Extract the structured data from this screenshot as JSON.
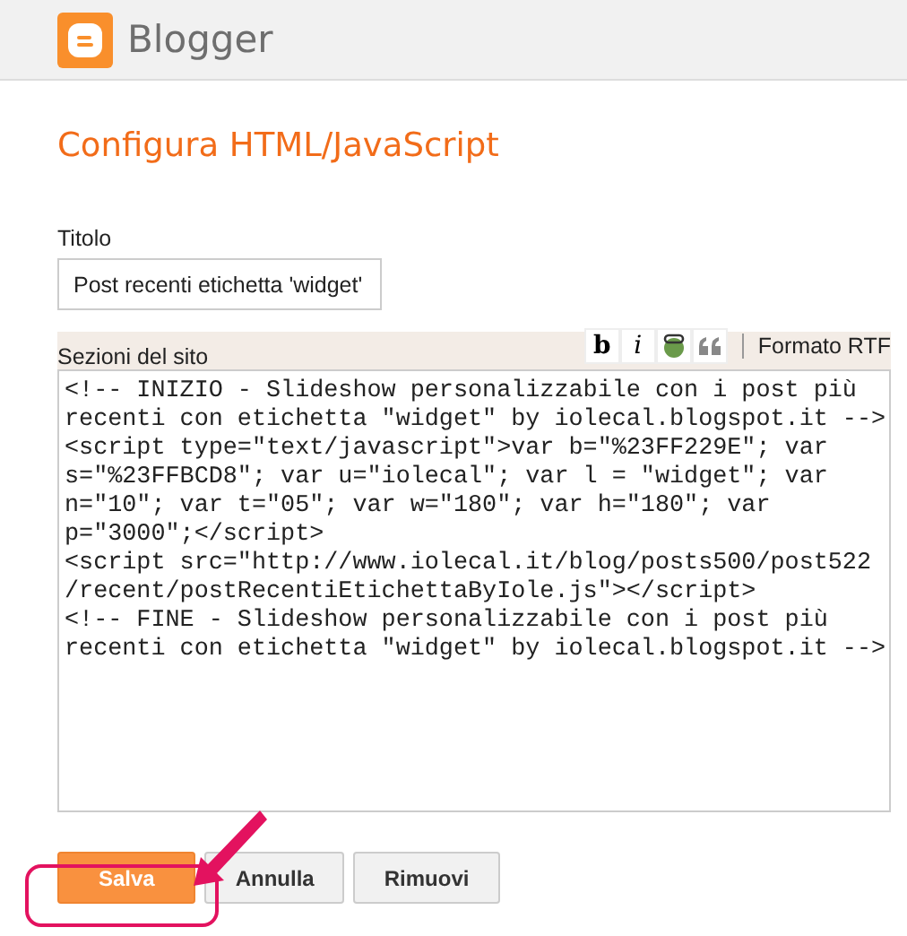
{
  "header": {
    "brand": "Blogger"
  },
  "page_title": "Configura HTML/JavaScript",
  "title_field": {
    "label": "Titolo",
    "value": "Post recenti etichetta 'widget'"
  },
  "content_field": {
    "label": "Sezioni del sito",
    "toolbar": [
      {
        "kind": "bold",
        "label": "b"
      },
      {
        "kind": "italic",
        "label": "i"
      },
      {
        "kind": "link"
      },
      {
        "kind": "quote"
      }
    ],
    "rich_text_link": "Formato RTF",
    "lines": [
      "<!-- INIZIO - Slideshow personalizzabile con i post più",
      "recenti con etichetta \"widget\" by iolecal.blogspot.it -->",
      "<script type=\"text/javascript\">var b=\"%23FF229E\"; var",
      "s=\"%23FFBCD8\"; var u=\"iolecal\"; var l = \"widget\"; var",
      "n=\"10\"; var t=\"05\"; var w=\"180\"; var h=\"180\"; var",
      "p=\"3000\";</script>",
      "<script src=\"http://www.iolecal.it/blog/posts500/post522",
      "/recent/postRecentiEtichettaByIole.js\"></script>",
      "<!-- FINE - Slideshow personalizzabile con i post più",
      "recenti con etichetta \"widget\" by iolecal.blogspot.it -->"
    ]
  },
  "buttons": [
    {
      "kind": "primary",
      "label": "Salva"
    },
    {
      "kind": "secondary",
      "label": "Annulla"
    },
    {
      "kind": "secondary",
      "label": "Rimuovi"
    }
  ]
}
